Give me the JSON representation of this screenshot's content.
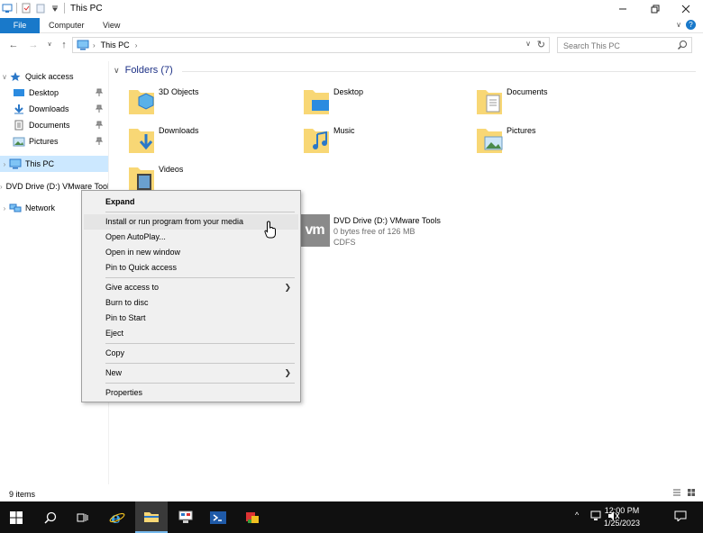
{
  "window": {
    "title": "This PC"
  },
  "ribbon": {
    "tabs": [
      "File",
      "Computer",
      "View"
    ]
  },
  "address": {
    "crumb": "This PC",
    "search_placeholder": "Search This PC"
  },
  "navpane": {
    "quick_access": "Quick access",
    "pinned": [
      "Desktop",
      "Downloads",
      "Documents",
      "Pictures"
    ],
    "this_pc": "This PC",
    "dvd": "DVD Drive (D:) VMware Tools",
    "network": "Network"
  },
  "content": {
    "group_label": "Folders (7)",
    "folders": [
      "3D Objects",
      "Desktop",
      "Documents",
      "Downloads",
      "Music",
      "Pictures",
      "Videos"
    ],
    "drive": {
      "name": "DVD Drive (D:) VMware Tools",
      "logo": "vm",
      "free": "0 bytes free of 126 MB",
      "fs": "CDFS"
    }
  },
  "context_menu": {
    "items": [
      "Expand",
      "Install or run program from your media",
      "Open AutoPlay...",
      "Open in new window",
      "Pin to Quick access",
      "Give access to",
      "Burn to disc",
      "Pin to Start",
      "Eject",
      "Copy",
      "New",
      "Properties"
    ]
  },
  "status": {
    "count": "9 items"
  },
  "taskbar": {
    "time": "12:00 PM",
    "date": "1/25/2023"
  },
  "colors": {
    "accent": "#1979ca",
    "selected": "#cce8ff",
    "folder": "#f8d775",
    "taskbar": "#101010"
  }
}
